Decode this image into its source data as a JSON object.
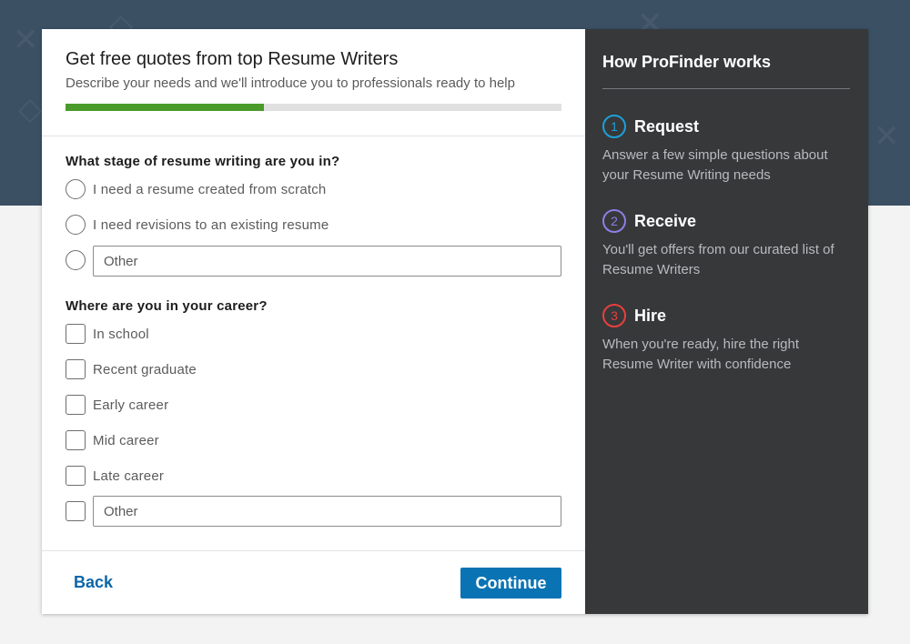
{
  "form": {
    "title": "Get free quotes from top Resume Writers",
    "subtitle": "Describe your needs and we'll introduce you to professionals ready to help",
    "progress_percent": 40,
    "question1": {
      "label": "What stage of resume writing are you in?",
      "options": [
        "I need a resume created from scratch",
        "I need revisions to an existing resume"
      ],
      "other_placeholder": "Other"
    },
    "question2": {
      "label": "Where are you in your career?",
      "options": [
        "In school",
        "Recent graduate",
        "Early career",
        "Mid career",
        "Late career"
      ],
      "other_placeholder": "Other"
    },
    "back_label": "Back",
    "continue_label": "Continue"
  },
  "sidebar": {
    "title": "How ProFinder works",
    "steps": [
      {
        "number": "1",
        "title": "Request",
        "description": "Answer a few simple questions about your Resume Writing needs",
        "color": "#1e9fd8"
      },
      {
        "number": "2",
        "title": "Receive",
        "description": "You'll get offers from our curated list of Resume Writers",
        "color": "#8f7ee6"
      },
      {
        "number": "3",
        "title": "Hire",
        "description": "When you're ready, hire the right Resume Writer with confidence",
        "color": "#e8403d"
      }
    ]
  },
  "colors": {
    "brand_blue": "#0a73b4",
    "progress_green": "#4a9b2a",
    "sidebar_bg": "#36383a"
  }
}
